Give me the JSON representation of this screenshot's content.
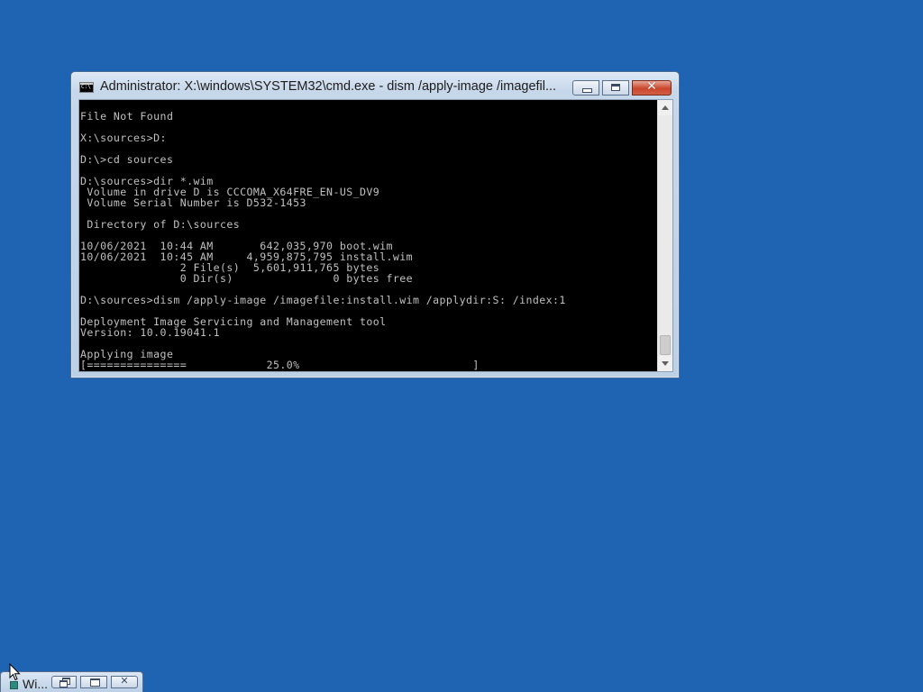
{
  "window": {
    "title": "Administrator: X:\\windows\\SYSTEM32\\cmd.exe - dism  /apply-image /imagefil...",
    "icon": "cmd-icon",
    "buttons": {
      "minimize": "minimize",
      "maximize": "maximize",
      "close": "close"
    }
  },
  "console": {
    "lines": [
      "File Not Found",
      "",
      "X:\\sources>D:",
      "",
      "D:\\>cd sources",
      "",
      "D:\\sources>dir *.wim",
      " Volume in drive D is CCCOMA_X64FRE_EN-US_DV9",
      " Volume Serial Number is D532-1453",
      "",
      " Directory of D:\\sources",
      "",
      "10/06/2021  10:44 AM       642,035,970 boot.wim",
      "10/06/2021  10:45 AM     4,959,875,795 install.wim",
      "               2 File(s)  5,601,911,765 bytes",
      "               0 Dir(s)               0 bytes free",
      "",
      "D:\\sources>dism /apply-image /imagefile:install.wim /applydir:S: /index:1",
      "",
      "Deployment Image Servicing and Management tool",
      "Version: 10.0.19041.1",
      "",
      "Applying image",
      "[===============            25.0%                          ]"
    ],
    "progress_percent": 25.0
  },
  "taskbar_window": {
    "title": "Wi...",
    "icon": "setup-icon"
  },
  "colors": {
    "desktop": "#1f64b3",
    "console_bg": "#000000",
    "console_text": "#c0c0c0"
  }
}
